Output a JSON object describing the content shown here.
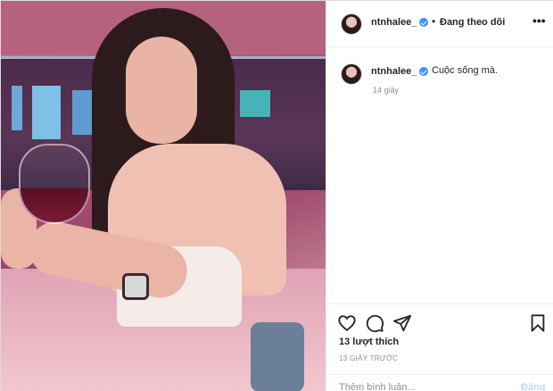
{
  "post": {
    "author": {
      "username": "ntnhalee_",
      "verified": true,
      "follow_status": "Đang theo dõi"
    },
    "caption": {
      "username": "ntnhalee_",
      "text": "Cuộc sống mà.",
      "relative_time": "14 giây"
    },
    "likes_text": "13 lượt thích",
    "timestamp": "13 GIÂY TRƯỚC",
    "comment_box": {
      "placeholder": "Thêm bình luận...",
      "post_label": "Đăng"
    },
    "icons": {
      "more": "more-options-icon",
      "like": "heart-icon",
      "comment": "comment-bubble-icon",
      "share": "paper-plane-icon",
      "save": "bookmark-icon"
    },
    "colors": {
      "verified_badge": "#3897f0",
      "post_button_disabled": "#b2dffc",
      "secondary_text": "#8e8e8e",
      "border": "#dbdbdb"
    }
  }
}
